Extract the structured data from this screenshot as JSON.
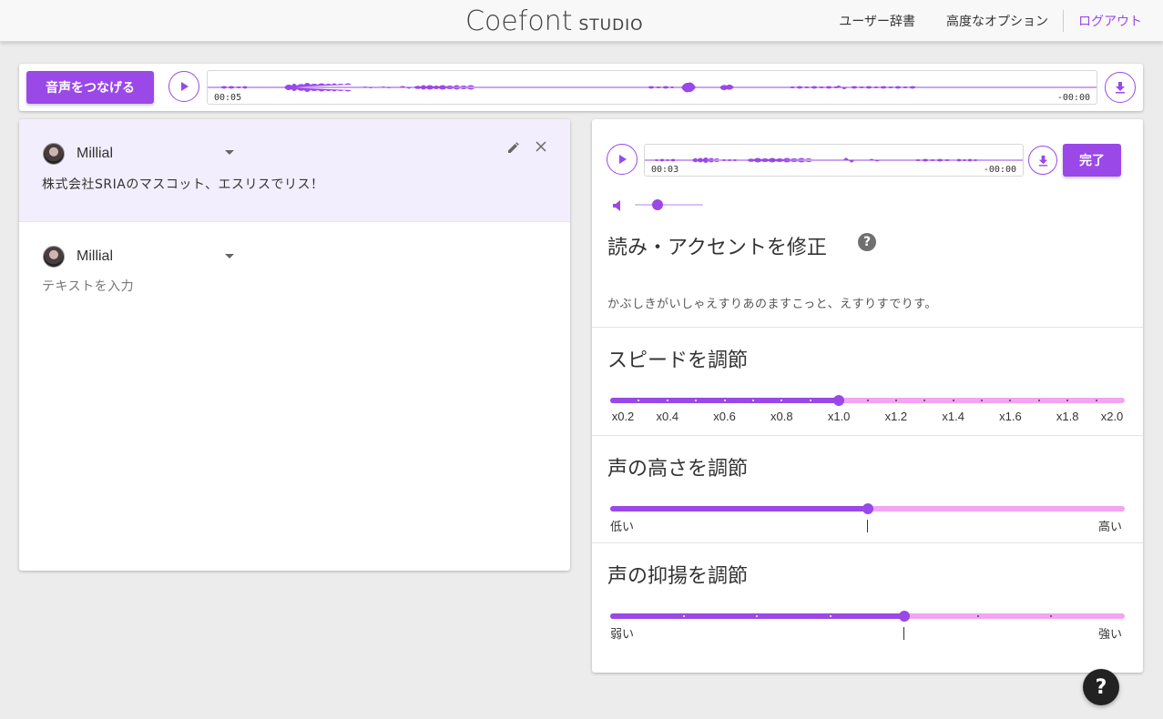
{
  "app": {
    "logo_main": "Coefont",
    "logo_sub": "STUDIO"
  },
  "nav": {
    "dictionary": "ユーザー辞書",
    "advanced": "高度なオプション",
    "logout": "ログアウト"
  },
  "topbar": {
    "join_label": "音声をつなげる",
    "time_current": "00:05",
    "time_remaining": "-00:00"
  },
  "rows": [
    {
      "speaker": "Millial",
      "text": "株式会社SRIAのマスコット、エスリスでリス！"
    },
    {
      "speaker": "Millial",
      "placeholder": "テキストを入力"
    }
  ],
  "editor": {
    "time_current": "00:03",
    "time_remaining": "-00:00",
    "done_label": "完了",
    "volume_level": 0.33,
    "accent_title": "読み・アクセントを修正",
    "reading": "かぶしきがいしゃえすりあのますこっと、えすりすでりす。",
    "speed": {
      "title": "スピードを調節",
      "ticks": [
        "x0.2",
        "x0.4",
        "x0.6",
        "x0.8",
        "x1.0",
        "x1.2",
        "x1.4",
        "x1.6",
        "x1.8",
        "x2.0"
      ],
      "value": "x1.0"
    },
    "pitch": {
      "title": "声の高さを調節",
      "low": "低い",
      "high": "高い",
      "value": 0.5
    },
    "intonation": {
      "title": "声の抑揚を調節",
      "low": "弱い",
      "high": "強い",
      "value": 0.571
    }
  },
  "colors": {
    "accent": "#9a48e8",
    "track_light": "#f3a4f3",
    "active_row": "#f3eefd"
  },
  "help_label": "?"
}
